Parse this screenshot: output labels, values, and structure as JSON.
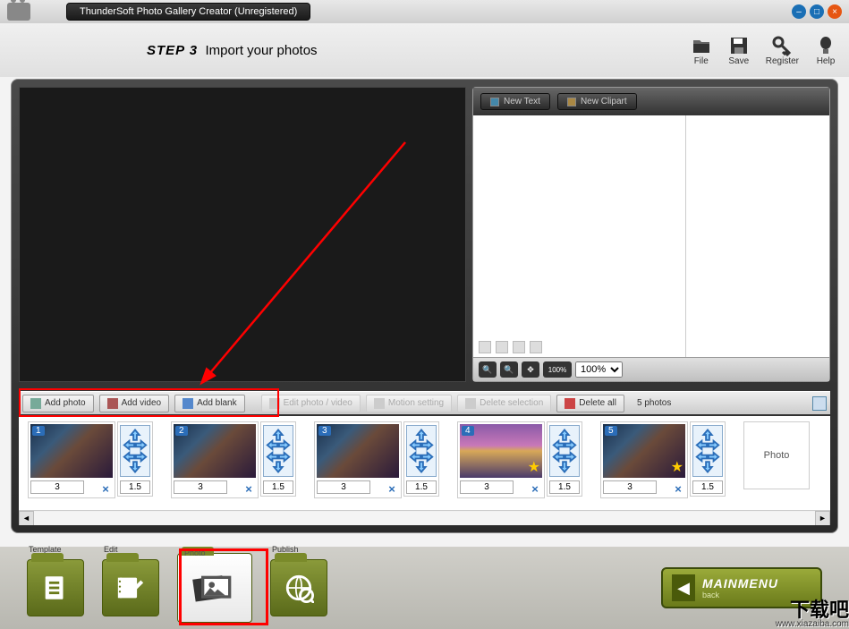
{
  "window": {
    "title": "ThunderSoft Photo Gallery Creator (Unregistered)"
  },
  "header": {
    "step": "STEP 3",
    "subtitle": "Import your photos"
  },
  "tools": {
    "file": "File",
    "save": "Save",
    "register": "Register",
    "help": "Help"
  },
  "side": {
    "new_text": "New Text",
    "new_clipart": "New Clipart",
    "zoom_100_label": "100%",
    "zoom_select": "100%"
  },
  "toolbar": {
    "add_photo": "Add photo",
    "add_video": "Add video",
    "add_blank": "Add blank",
    "edit": "Edit photo / video",
    "motion": "Motion setting",
    "delete_sel": "Delete selection",
    "delete_all": "Delete all",
    "count": "5 photos"
  },
  "thumbs": [
    {
      "num": "1",
      "dur": "3",
      "trans": "1.5"
    },
    {
      "num": "2",
      "dur": "3",
      "trans": "1.5"
    },
    {
      "num": "3",
      "dur": "3",
      "trans": "1.5"
    },
    {
      "num": "4",
      "dur": "3",
      "trans": "1.5",
      "city": true,
      "star": true
    },
    {
      "num": "5",
      "dur": "3",
      "trans": "1.5",
      "star": true
    }
  ],
  "blank_label": "Photo",
  "nav": {
    "template": "Template",
    "edit": "Edit",
    "photo": "Photo",
    "publish": "Publish"
  },
  "mainmenu": {
    "label": "MAINMENU",
    "sub": "back"
  },
  "watermark": {
    "big": "下载吧",
    "url": "www.xiazaiba.com"
  }
}
